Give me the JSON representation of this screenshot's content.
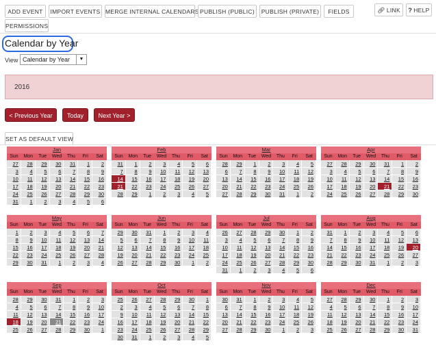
{
  "toolbar": {
    "buttons": [
      "ADD EVENT",
      "IMPORT EVENTS",
      "MERGE INTERNAL CALENDARS",
      "PUBLISH (PUBLIC)",
      "PUBLISH (PRIVATE)",
      "FIELDS",
      "PERMISSIONS"
    ],
    "link_label": "LINK",
    "help_label": "HELP"
  },
  "page_title": "Calendar by Year",
  "view": {
    "label": "View",
    "selected": "Calendar by Year"
  },
  "year_banner": "2016",
  "nav": {
    "prev": "< Previous Year",
    "today": "Today",
    "next": "Next Year >"
  },
  "set_default_label": "SET AS DEFAULT VIEW",
  "weekdays": [
    "Sun",
    "Mon",
    "Tue",
    "Wed",
    "Thu",
    "Fri",
    "Sat"
  ],
  "months": [
    {
      "name": "Jan",
      "days": [
        "27",
        "28",
        "29",
        "30",
        "31",
        "1",
        "2",
        "3",
        "4",
        "5",
        "6",
        "7",
        "8",
        "9",
        "10",
        "11",
        "12",
        "13",
        "14",
        "15",
        "16",
        "17",
        "18",
        "19",
        "20",
        "21",
        "22",
        "23",
        "24",
        "25",
        "26",
        "27",
        "28",
        "29",
        "30",
        "31",
        "1",
        "2",
        "3",
        "4",
        "5",
        "6"
      ],
      "highlights": [],
      "grey": []
    },
    {
      "name": "Feb",
      "days": [
        "31",
        "1",
        "2",
        "3",
        "4",
        "5",
        "6",
        "7",
        "8",
        "9",
        "10",
        "11",
        "12",
        "13",
        "14",
        "15",
        "16",
        "17",
        "18",
        "19",
        "20",
        "21",
        "22",
        "23",
        "24",
        "25",
        "26",
        "27",
        "28",
        "29",
        "1",
        "2",
        "3",
        "4",
        "5"
      ],
      "highlights": [
        14,
        21
      ],
      "grey": []
    },
    {
      "name": "Mar",
      "days": [
        "28",
        "29",
        "1",
        "2",
        "3",
        "4",
        "5",
        "6",
        "7",
        "8",
        "9",
        "10",
        "11",
        "12",
        "13",
        "14",
        "15",
        "16",
        "17",
        "18",
        "19",
        "20",
        "21",
        "22",
        "23",
        "24",
        "25",
        "26",
        "27",
        "28",
        "29",
        "30",
        "31",
        "1",
        "2"
      ],
      "highlights": [],
      "grey": []
    },
    {
      "name": "Apr",
      "days": [
        "27",
        "28",
        "29",
        "30",
        "31",
        "1",
        "2",
        "3",
        "4",
        "5",
        "6",
        "7",
        "8",
        "9",
        "10",
        "11",
        "12",
        "13",
        "14",
        "15",
        "16",
        "17",
        "18",
        "19",
        "20",
        "21",
        "22",
        "23",
        "24",
        "25",
        "26",
        "27",
        "28",
        "29",
        "30"
      ],
      "highlights": [
        25
      ],
      "grey": []
    },
    {
      "name": "May",
      "days": [
        "1",
        "2",
        "3",
        "4",
        "5",
        "6",
        "7",
        "8",
        "9",
        "10",
        "11",
        "12",
        "13",
        "14",
        "15",
        "16",
        "17",
        "18",
        "19",
        "20",
        "21",
        "22",
        "23",
        "24",
        "25",
        "26",
        "27",
        "28",
        "29",
        "30",
        "31",
        "1",
        "2",
        "3",
        "4"
      ],
      "highlights": [],
      "grey": []
    },
    {
      "name": "Jun",
      "days": [
        "29",
        "30",
        "31",
        "1",
        "2",
        "3",
        "4",
        "5",
        "6",
        "7",
        "8",
        "9",
        "10",
        "11",
        "12",
        "13",
        "14",
        "15",
        "16",
        "17",
        "18",
        "19",
        "20",
        "21",
        "22",
        "23",
        "24",
        "25",
        "26",
        "27",
        "28",
        "29",
        "30",
        "1",
        "2"
      ],
      "highlights": [],
      "grey": []
    },
    {
      "name": "Jul",
      "days": [
        "26",
        "27",
        "28",
        "29",
        "30",
        "1",
        "2",
        "3",
        "4",
        "5",
        "6",
        "7",
        "8",
        "9",
        "10",
        "11",
        "12",
        "13",
        "14",
        "15",
        "16",
        "17",
        "18",
        "19",
        "20",
        "21",
        "22",
        "23",
        "24",
        "25",
        "26",
        "27",
        "28",
        "29",
        "30",
        "31",
        "1",
        "2",
        "3",
        "4",
        "5",
        "6"
      ],
      "highlights": [],
      "grey": []
    },
    {
      "name": "Aug",
      "days": [
        "31",
        "1",
        "2",
        "3",
        "4",
        "5",
        "6",
        "7",
        "8",
        "9",
        "10",
        "11",
        "12",
        "13",
        "14",
        "15",
        "16",
        "17",
        "18",
        "19",
        "20",
        "21",
        "22",
        "23",
        "24",
        "25",
        "26",
        "27",
        "28",
        "29",
        "30",
        "31",
        "1",
        "2",
        "3"
      ],
      "highlights": [
        20
      ],
      "grey": []
    },
    {
      "name": "Sep",
      "days": [
        "28",
        "29",
        "30",
        "31",
        "1",
        "2",
        "3",
        "4",
        "5",
        "6",
        "7",
        "8",
        "9",
        "10",
        "11",
        "12",
        "13",
        "14",
        "15",
        "16",
        "17",
        "18",
        "19",
        "20",
        "21",
        "22",
        "23",
        "24",
        "25",
        "26",
        "27",
        "28",
        "29",
        "30",
        "1"
      ],
      "highlights": [
        21
      ],
      "grey": [
        24
      ]
    },
    {
      "name": "Oct",
      "days": [
        "25",
        "26",
        "27",
        "28",
        "29",
        "30",
        "1",
        "2",
        "3",
        "4",
        "5",
        "6",
        "7",
        "8",
        "9",
        "10",
        "11",
        "12",
        "13",
        "14",
        "15",
        "16",
        "17",
        "18",
        "19",
        "20",
        "21",
        "22",
        "23",
        "24",
        "25",
        "26",
        "27",
        "28",
        "29",
        "30",
        "31",
        "1",
        "2",
        "3",
        "4",
        "5"
      ],
      "highlights": [],
      "grey": []
    },
    {
      "name": "Nov",
      "days": [
        "30",
        "31",
        "1",
        "2",
        "3",
        "4",
        "5",
        "6",
        "7",
        "8",
        "9",
        "10",
        "11",
        "12",
        "13",
        "14",
        "15",
        "16",
        "17",
        "18",
        "19",
        "20",
        "21",
        "22",
        "23",
        "24",
        "25",
        "26",
        "27",
        "28",
        "29",
        "30",
        "1",
        "2",
        "3"
      ],
      "highlights": [],
      "grey": []
    },
    {
      "name": "Dec",
      "days": [
        "27",
        "28",
        "29",
        "30",
        "1",
        "2",
        "3",
        "4",
        "5",
        "6",
        "7",
        "8",
        "9",
        "10",
        "11",
        "12",
        "13",
        "14",
        "15",
        "16",
        "17",
        "18",
        "19",
        "20",
        "21",
        "22",
        "23",
        "24",
        "25",
        "26",
        "27",
        "28",
        "29",
        "30",
        "31"
      ],
      "highlights": [],
      "grey": []
    }
  ]
}
